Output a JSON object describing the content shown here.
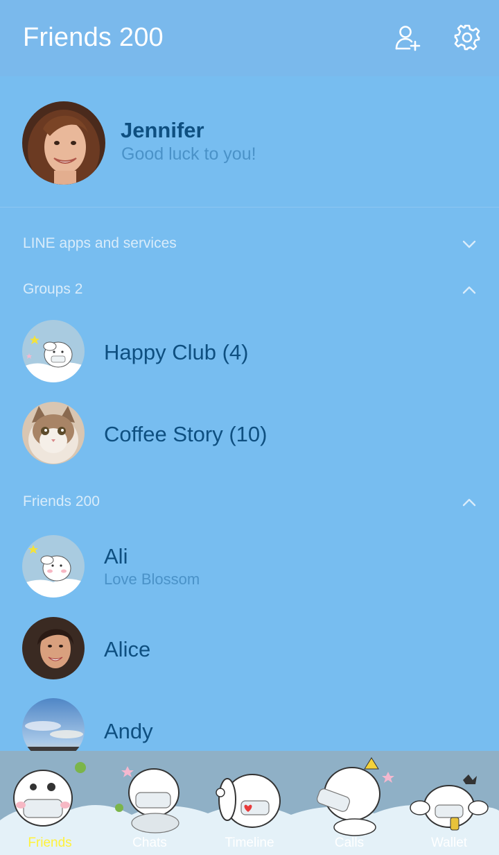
{
  "header": {
    "title": "Friends 200",
    "add_friend_icon": "add-user-icon",
    "settings_icon": "gear-icon"
  },
  "profile": {
    "name": "Jennifer",
    "status": "Good luck to you!"
  },
  "sections": {
    "services": {
      "label": "LINE apps and services",
      "state": "collapsed"
    },
    "groups": {
      "label": "Groups 2",
      "state": "expanded"
    },
    "friends": {
      "label": "Friends 200",
      "state": "expanded"
    }
  },
  "groups": [
    {
      "name": "Happy Club (4)"
    },
    {
      "name": "Coffee Story (10)"
    }
  ],
  "friends": [
    {
      "name": "Ali",
      "status": "Love Blossom"
    },
    {
      "name": "Alice"
    },
    {
      "name": "Andy"
    }
  ],
  "tabs": [
    {
      "label": "Friends",
      "active": true
    },
    {
      "label": "Chats"
    },
    {
      "label": "Timeline"
    },
    {
      "label": "Calls"
    },
    {
      "label": "Wallet"
    }
  ],
  "colors": {
    "background": "#77bdf0",
    "header": "#7ab9ec",
    "name_text": "#0e4f80",
    "status_text": "#4a92c8",
    "section_text": "#d9ecfa",
    "active_tab": "#fff23a"
  }
}
